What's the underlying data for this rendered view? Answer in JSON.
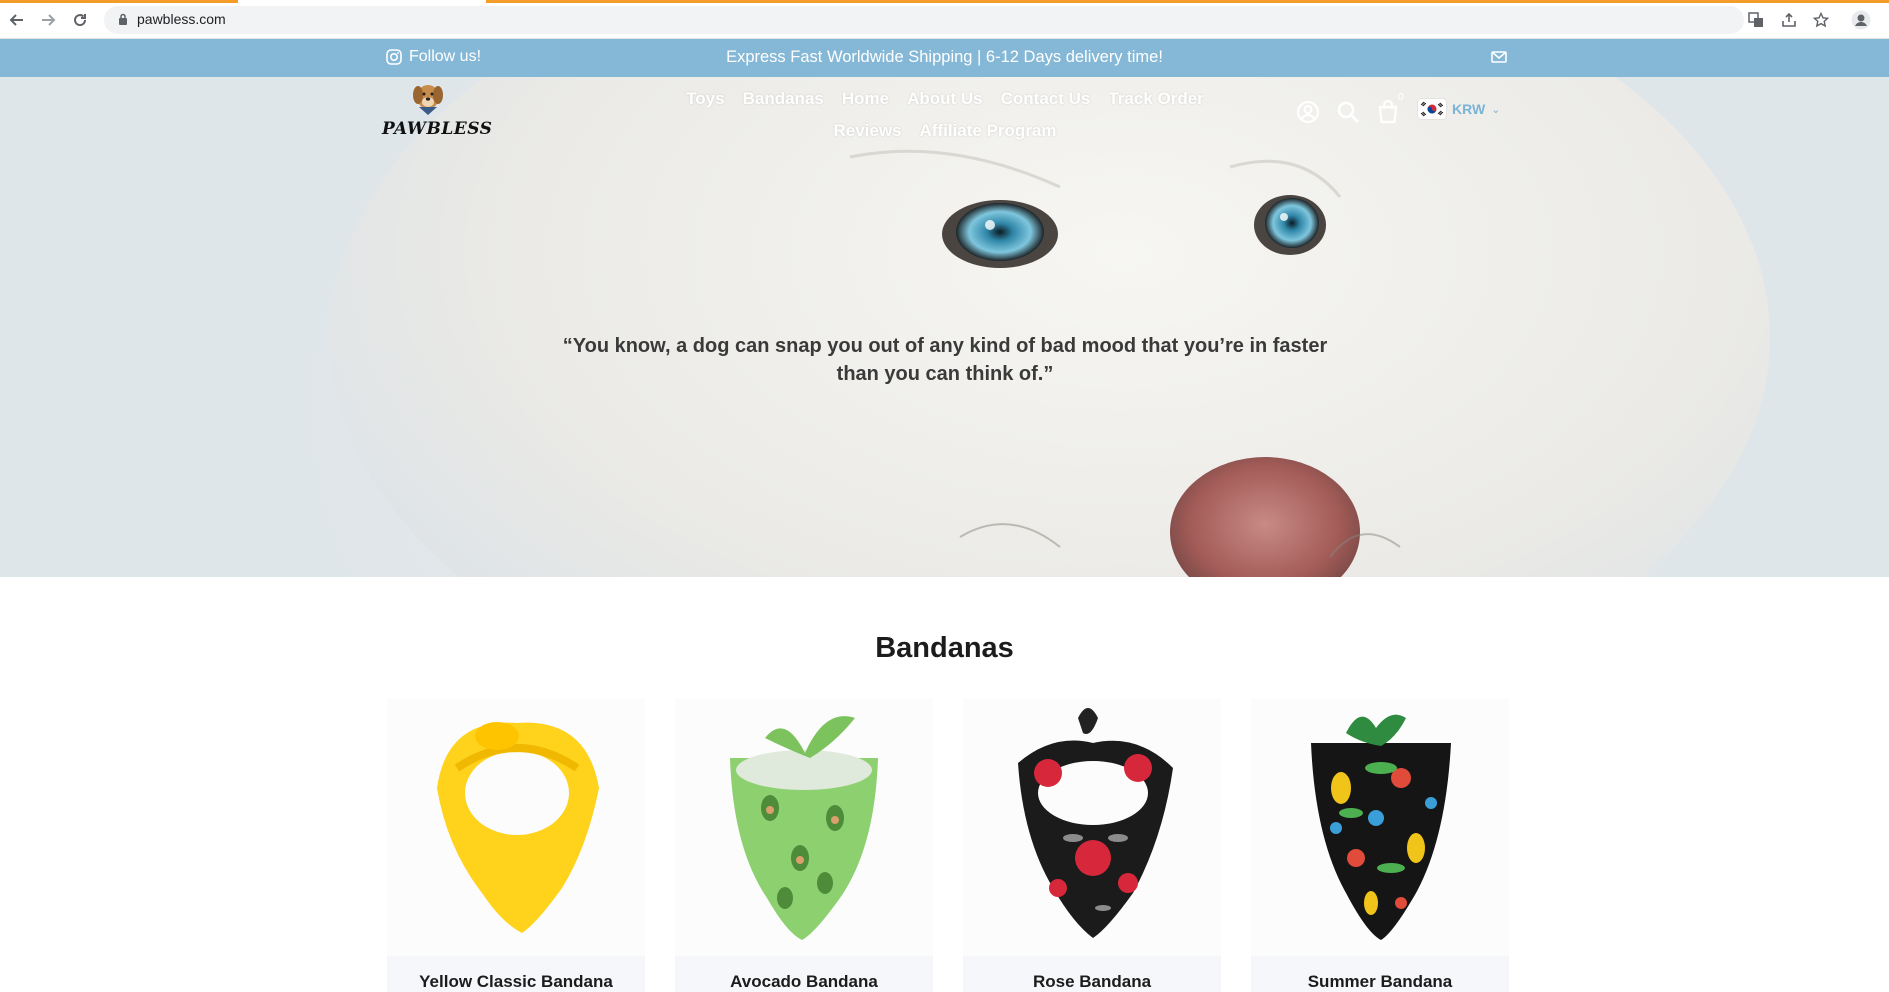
{
  "browser": {
    "url": "pawbless.com"
  },
  "announcement": {
    "follow_label": "Follow us!",
    "shipping_text": "Express Fast Worldwide Shipping | 6-12 Days delivery time!"
  },
  "header": {
    "logo_text": "PAWBLESS",
    "nav": [
      "Toys",
      "Bandanas",
      "Home",
      "About Us",
      "Contact Us",
      "Track Order",
      "Reviews",
      "Affiliate Program"
    ],
    "cart_count": "0",
    "currency": "KRW"
  },
  "hero": {
    "quote": "“You know, a dog can snap you out of any kind of bad mood that you’re in faster than you can think of.”"
  },
  "section": {
    "title": "Bandanas",
    "products": [
      {
        "name": "Yellow Classic Bandana"
      },
      {
        "name": "Avocado Bandana"
      },
      {
        "name": "Rose Bandana"
      },
      {
        "name": "Summer Bandana"
      }
    ]
  },
  "colors": {
    "announcement_bg": "#84b8d6",
    "loading_bar": "#f39c2a",
    "currency_text": "#7ab4d6"
  },
  "icons": [
    "back-icon",
    "forward-icon",
    "reload-icon",
    "lock-icon",
    "translate-icon",
    "share-icon",
    "bookmark-star-icon",
    "profile-icon",
    "instagram-icon",
    "mail-icon",
    "account-icon",
    "search-icon",
    "cart-icon",
    "korea-flag-icon",
    "chevron-down-icon"
  ]
}
